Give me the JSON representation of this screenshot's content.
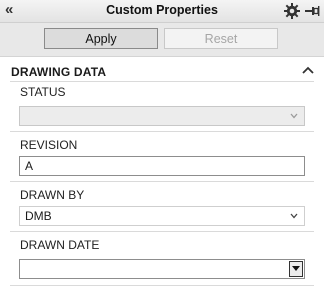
{
  "panel": {
    "title": "Custom Properties",
    "collapse_glyph": "«",
    "settings_icon": "gear-icon",
    "pin_icon": "pin-icon"
  },
  "toolbar": {
    "apply_label": "Apply",
    "reset_label": "Reset"
  },
  "section": {
    "title": "DRAWING DATA",
    "expanded": true
  },
  "fields": {
    "status": {
      "label": "STATUS",
      "value": ""
    },
    "revision": {
      "label": "REVISION",
      "value": "A"
    },
    "drawn_by": {
      "label": "DRAWN BY",
      "value": "DMB"
    },
    "drawn_date": {
      "label": "DRAWN DATE",
      "value": ""
    }
  },
  "colors": {
    "header_bg": "#e8e8e8",
    "disabled_text": "#a6a6a6",
    "border": "#8d8d8d"
  }
}
